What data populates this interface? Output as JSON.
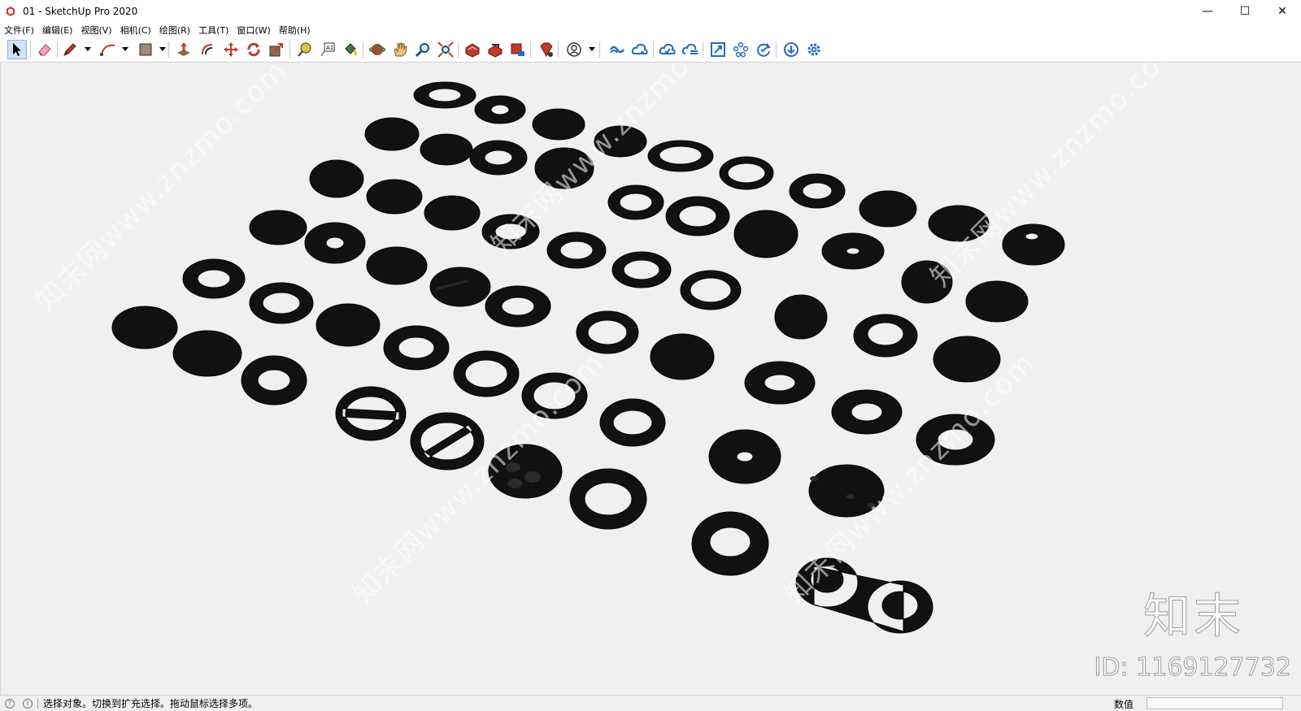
{
  "window": {
    "title": "01 - SketchUp Pro 2020"
  },
  "menu": [
    "文件(F)",
    "编辑(E)",
    "视图(V)",
    "相机(C)",
    "绘图(R)",
    "工具(T)",
    "窗口(W)",
    "帮助(H)"
  ],
  "toolbar": {
    "tools": [
      {
        "name": "select-tool",
        "icon": "arrow-cursor-icon",
        "active": true
      },
      {
        "name": "eraser-tool",
        "icon": "eraser-icon"
      },
      {
        "name": "line-tool",
        "icon": "pencil-icon"
      },
      {
        "name": "arc-tool",
        "icon": "arc-icon"
      },
      {
        "name": "shape-tool",
        "icon": "rectangle-icon"
      },
      {
        "name": "push-pull-tool",
        "icon": "push-pull-icon"
      },
      {
        "name": "offset-tool",
        "icon": "offset-icon"
      },
      {
        "name": "move-tool",
        "icon": "move-arrows-icon"
      },
      {
        "name": "rotate-tool",
        "icon": "rotate-icon"
      },
      {
        "name": "scale-tool",
        "icon": "scale-icon"
      },
      {
        "name": "tape-measure-tool",
        "icon": "tape-measure-icon"
      },
      {
        "name": "text-tool",
        "icon": "text-a1-icon"
      },
      {
        "name": "paint-bucket-tool",
        "icon": "paint-bucket-icon"
      },
      {
        "name": "orbit-tool",
        "icon": "orbit-icon"
      },
      {
        "name": "pan-tool",
        "icon": "hand-icon"
      },
      {
        "name": "zoom-tool",
        "icon": "magnifier-icon"
      },
      {
        "name": "zoom-extents-tool",
        "icon": "zoom-extents-icon"
      },
      {
        "name": "warehouse-tool",
        "icon": "3d-warehouse-icon"
      },
      {
        "name": "share-model-tool",
        "icon": "share-model-icon"
      },
      {
        "name": "extension-warehouse-tool",
        "icon": "extension-warehouse-icon"
      },
      {
        "name": "ruby-tool",
        "icon": "ruby-gem-icon"
      },
      {
        "name": "account-tool",
        "icon": "user-account-icon"
      },
      {
        "name": "trimble-connect-tool",
        "icon": "connect-icon"
      },
      {
        "name": "cloud-share-tool",
        "icon": "cloud-share-icon"
      },
      {
        "name": "cloud-sync-tool",
        "icon": "cloud-sync-icon"
      },
      {
        "name": "cloud-layers-tool",
        "icon": "cloud-layers-icon"
      },
      {
        "name": "fit-view-tool",
        "icon": "fit-view-icon"
      },
      {
        "name": "cluster-tool",
        "icon": "cluster-icon"
      },
      {
        "name": "check-tool",
        "icon": "refresh-check-icon"
      },
      {
        "name": "download-tool",
        "icon": "download-icon"
      },
      {
        "name": "settings-tool",
        "icon": "gear-icon"
      }
    ]
  },
  "viewport": {
    "background_color": "#f0f0f0",
    "object_color": "#111111",
    "watermark_text": "知末网www.znzmo.com",
    "logo_text": "知末",
    "id_text": "ID: 1169127732"
  },
  "status": {
    "text": "选择对象。切换到扩充选择。拖动鼠标选择多项。",
    "measurements_label": "数值",
    "measurements_value": ""
  }
}
